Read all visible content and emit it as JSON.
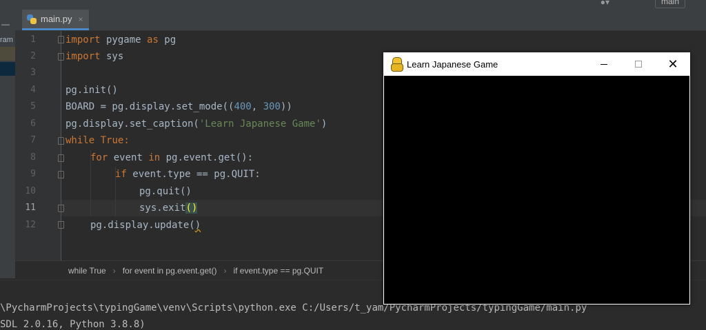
{
  "ide": {
    "branch_label": "main",
    "left_strip_text": "ram",
    "tab": {
      "label": "main.py",
      "close_glyph": "×",
      "icon": "python-file-icon"
    },
    "line_numbers": [
      "1",
      "2",
      "3",
      "4",
      "5",
      "6",
      "7",
      "8",
      "9",
      "10",
      "11",
      "12"
    ],
    "code": {
      "l1": {
        "kw1": "import",
        "mid": " pygame ",
        "kw2": "as",
        "end": " pg"
      },
      "l2": {
        "kw": "import",
        "rest": " sys"
      },
      "l4": "pg.init()",
      "l5": {
        "pre": "BOARD = pg.display.set_mode((",
        "n1": "400",
        "comma": ", ",
        "n2": "300",
        "post": "))"
      },
      "l6": {
        "pre": "pg.display.set_caption(",
        "str": "'Learn Japanese Game'",
        "post": ")"
      },
      "l7": {
        "kw": "while",
        "sp": " ",
        "kw2": "True",
        "post": ":"
      },
      "l8": {
        "kw": "for",
        "mid": " event ",
        "kw2": "in",
        "post": " pg.event.get():"
      },
      "l9": {
        "kw": "if",
        "post": " event.type == pg.QUIT:"
      },
      "l10": "pg.quit()",
      "l11": {
        "pre": "sys.exit",
        "br1": "(",
        "br2": ")"
      },
      "l12": {
        "pre": "pg.display.update(",
        "post": ")"
      }
    },
    "breadcrumb": [
      "while True",
      "for event in pg.event.get()",
      "if event.type == pg.QUIT"
    ],
    "breadcrumb_sep": "›",
    "terminal": {
      "line1": "\\PycharmProjects\\typingGame\\venv\\Scripts\\python.exe C:/Users/t_yam/PycharmProjects/typingGame/main.py",
      "line2": "SDL 2.0.16, Python 3.8.8)"
    }
  },
  "game_window": {
    "title": "Learn Japanese Game",
    "icon": "pygame-snake-icon",
    "close_glyph": "✕"
  },
  "colors": {
    "editor_bg": "#2b2b2b",
    "keyword": "#cc7832",
    "number": "#6897bb",
    "string": "#6a8759",
    "text": "#a9b7c6"
  }
}
